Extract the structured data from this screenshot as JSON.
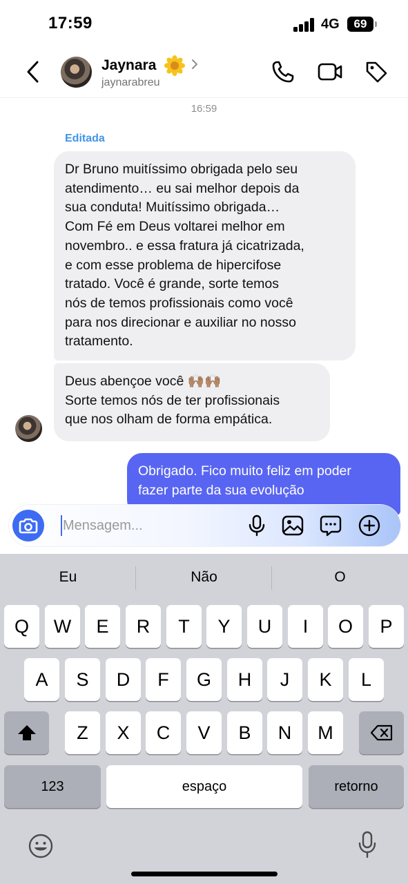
{
  "status_bar": {
    "time": "17:59",
    "network": "4G",
    "battery": "69"
  },
  "header": {
    "contact_name": "Jaynara",
    "contact_username": "jaynarabreu",
    "back_icon": "chevron-left-icon",
    "actions": [
      "phone-icon",
      "video-camera-icon",
      "tag-icon"
    ]
  },
  "conversation": {
    "timestamp": "16:59",
    "edited_label": "Editada",
    "incoming": [
      {
        "lines": [
          "Dr Bruno muitíssimo obrigada pelo seu",
          "atendimento… eu sai melhor depois da",
          "sua conduta! Muitíssimo obrigada…",
          "Com Fé em Deus voltarei melhor em",
          "novembro.. e essa fratura já cicatrizada,",
          "e com esse problema de hipercifose",
          "tratado. Você é grande, sorte temos",
          "nós de temos profissionais como você",
          "para nos direcionar e auxiliar no nosso",
          "tratamento."
        ]
      },
      {
        "lines": [
          "Deus abençoe você 🙌🏽🙌🏽",
          "Sorte temos nós de ter profissionais",
          "que nos olham de forma empática."
        ]
      }
    ],
    "outgoing": [
      {
        "lines": [
          "Obrigado. Fico muito feliz em poder",
          "fazer parte da sua evolução"
        ]
      }
    ]
  },
  "composer": {
    "placeholder": "Mensagem...",
    "accent_color": "#3d6bf2"
  },
  "keyboard": {
    "suggestions": [
      "Eu",
      "Não",
      "O"
    ],
    "row1": [
      "Q",
      "W",
      "E",
      "R",
      "T",
      "Y",
      "U",
      "I",
      "O",
      "P"
    ],
    "row2": [
      "A",
      "S",
      "D",
      "F",
      "G",
      "H",
      "J",
      "K",
      "L"
    ],
    "row3": [
      "Z",
      "X",
      "C",
      "V",
      "B",
      "N",
      "M"
    ],
    "numbers_key": "123",
    "space_key": "espaço",
    "return_key": "retorno"
  },
  "colors": {
    "outgoing_bubble": "#5865f2",
    "incoming_bubble": "#efeff1",
    "edited_label": "#3f95e8",
    "keyboard_bg": "#d1d3d9"
  }
}
